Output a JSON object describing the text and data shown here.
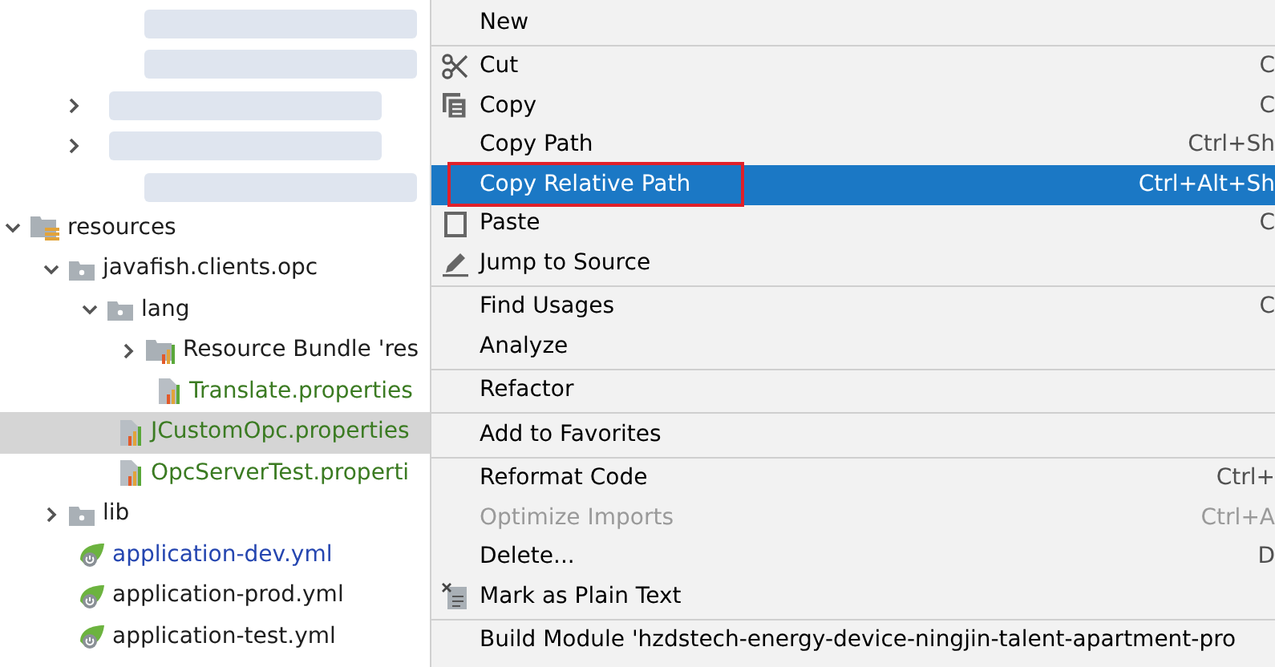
{
  "tree": {
    "blurred_rows": [
      {
        "has_arrow": false
      },
      {
        "has_arrow": false
      },
      {
        "has_arrow": true
      },
      {
        "has_arrow": true
      },
      {
        "has_arrow": false
      }
    ],
    "items": [
      {
        "label": "resources",
        "kind": "resource-folder",
        "expanded": true,
        "selected": false,
        "color": "#1e1e1e",
        "children": [
          {
            "label": "javafish.clients.opc",
            "kind": "folder",
            "expanded": true,
            "selected": false,
            "color": "#1e1e1e",
            "children": [
              {
                "label": "lang",
                "kind": "folder",
                "expanded": true,
                "selected": false,
                "color": "#1e1e1e",
                "children": [
                  {
                    "label": "Resource Bundle 'res",
                    "kind": "bundle",
                    "expanded": false,
                    "selected": false,
                    "color": "#1e1e1e"
                  },
                  {
                    "label": "Translate.properties",
                    "kind": "properties",
                    "selected": false,
                    "color": "#3b7b22"
                  }
                ]
              },
              {
                "label": "JCustomOpc.properties",
                "kind": "properties",
                "selected": true,
                "color": "#3b7b22"
              },
              {
                "label": "OpcServerTest.properti",
                "kind": "properties",
                "selected": false,
                "color": "#3b7b22"
              }
            ]
          },
          {
            "label": "lib",
            "kind": "folder",
            "expanded": false,
            "selected": false,
            "color": "#1e1e1e"
          },
          {
            "label": "application-dev.yml",
            "kind": "yaml",
            "selected": false,
            "color": "#2546b0"
          },
          {
            "label": "application-prod.yml",
            "kind": "yaml",
            "selected": false,
            "color": "#1e1e1e"
          },
          {
            "label": "application-test.yml",
            "kind": "yaml",
            "selected": false,
            "color": "#1e1e1e"
          }
        ]
      }
    ]
  },
  "menu": [
    {
      "kind": "item",
      "label": "New",
      "selected": false,
      "disabled": false
    },
    {
      "kind": "separator"
    },
    {
      "kind": "item",
      "label": "Cut",
      "shortcut": "C",
      "selected": false,
      "disabled": false
    },
    {
      "kind": "item",
      "label": "Copy",
      "shortcut": "C",
      "selected": false,
      "disabled": false
    },
    {
      "kind": "item",
      "label": "Copy Path",
      "shortcut": "Ctrl+Sh",
      "selected": false,
      "disabled": false
    },
    {
      "kind": "item",
      "label": "Copy Relative Path",
      "shortcut": "Ctrl+Alt+Sh",
      "selected": true,
      "disabled": false,
      "highlighted": true
    },
    {
      "kind": "item",
      "label": "Paste",
      "shortcut": "C",
      "selected": false,
      "disabled": false
    },
    {
      "kind": "item",
      "label": "Jump to Source",
      "selected": false,
      "disabled": false
    },
    {
      "kind": "separator"
    },
    {
      "kind": "item",
      "label": "Find Usages",
      "shortcut": "C",
      "selected": false,
      "disabled": false
    },
    {
      "kind": "item",
      "label": "Analyze",
      "selected": false,
      "disabled": false
    },
    {
      "kind": "separator"
    },
    {
      "kind": "item",
      "label": "Refactor",
      "selected": false,
      "disabled": false
    },
    {
      "kind": "separator"
    },
    {
      "kind": "item",
      "label": "Add to Favorites",
      "selected": false,
      "disabled": false
    },
    {
      "kind": "separator"
    },
    {
      "kind": "item",
      "label": "Reformat Code",
      "shortcut": "Ctrl+",
      "selected": false,
      "disabled": false
    },
    {
      "kind": "item",
      "label": "Optimize Imports",
      "shortcut": "Ctrl+A",
      "selected": false,
      "disabled": true
    },
    {
      "kind": "item",
      "label": "Delete...",
      "shortcut": "D",
      "selected": false,
      "disabled": false
    },
    {
      "kind": "item",
      "label": "Mark as Plain Text",
      "selected": false,
      "disabled": false
    },
    {
      "kind": "separator"
    },
    {
      "kind": "item",
      "label": "Build Module 'hzdstech-energy-device-ningjin-talent-apartment-pro",
      "selected": false,
      "disabled": false
    }
  ]
}
